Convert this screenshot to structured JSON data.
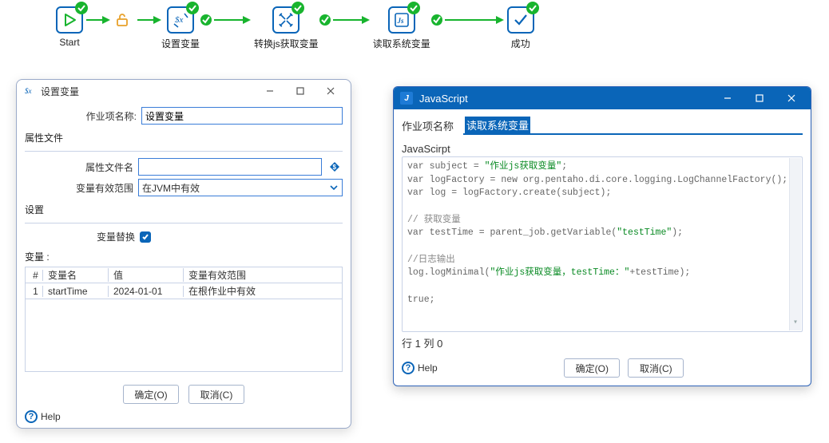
{
  "flow": {
    "nodes": [
      {
        "id": "start",
        "label": "Start"
      },
      {
        "id": "set-var",
        "label": "设置变量"
      },
      {
        "id": "js-get",
        "label": "转换js获取变量"
      },
      {
        "id": "read-sys",
        "label": "读取系统变量"
      },
      {
        "id": "success",
        "label": "成功"
      }
    ]
  },
  "dlg1": {
    "title": "设置变量",
    "jobItemLabel": "作业项名称:",
    "jobItemValue": "设置变量",
    "propFileGroup": "属性文件",
    "propFileNameLabel": "属性文件名",
    "propFileNameValue": "",
    "scopeLabel": "变量有效范围",
    "scopeValue": "在JVM中有效",
    "settingsGroup": "设置",
    "replaceLabel": "变量替换",
    "replaceChecked": true,
    "variablesHeader": "变量 :",
    "columns": {
      "idx": "#",
      "name": "变量名",
      "value": "值",
      "scope": "变量有效范围"
    },
    "rows": [
      {
        "idx": "1",
        "name": "startTime",
        "value": "2024-01-01",
        "scope": "在根作业中有效"
      }
    ],
    "help": "Help",
    "ok": "确定(O)",
    "cancel": "取消(C)"
  },
  "dlg2": {
    "title": "JavaScript",
    "jobItemLabel": "作业项名称",
    "jobItemValue": "读取系统变量",
    "codeSection": "JavaScirpt",
    "code_l1a": "var subject = ",
    "code_l1b": "\"作业js获取变量\"",
    "code_l1c": ";",
    "code_l2": "var logFactory = new org.pentaho.di.core.logging.LogChannelFactory();",
    "code_l3": "var log = logFactory.create(subject);",
    "code_c1": "// 获取变量",
    "code_l4a": "var testTime = parent_job.getVariable(",
    "code_l4b": "\"testTime\"",
    "code_l4c": ");",
    "code_c2": "//日志输出",
    "code_l5a": "log.logMinimal(",
    "code_l5b": "\"作业js获取变量，testTime：\"",
    "code_l5c": "+testTime);",
    "code_l6": "true;",
    "status": "行 1 列 0",
    "help": "Help",
    "ok": "确定(O)",
    "cancel": "取消(C)"
  }
}
